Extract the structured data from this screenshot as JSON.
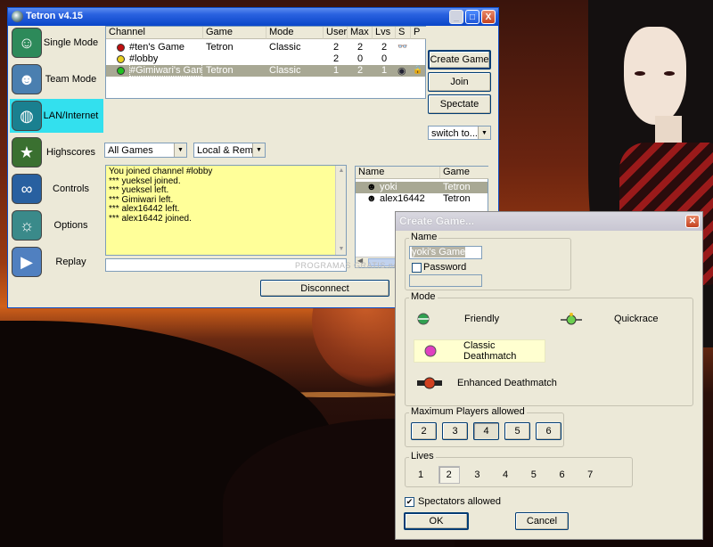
{
  "app": {
    "title": "Tetron v4.15",
    "window_buttons": [
      "_",
      "□",
      "X"
    ]
  },
  "nav": [
    {
      "label": "Single Mode",
      "icon": "single-mode-icon",
      "active": false
    },
    {
      "label": "Team Mode",
      "icon": "team-mode-icon",
      "active": false
    },
    {
      "label": "LAN/Internet",
      "icon": "globe-icon",
      "active": true
    },
    {
      "label": "Highscores",
      "icon": "highscores-icon",
      "active": false
    },
    {
      "label": "Controls",
      "icon": "controls-icon",
      "active": false
    },
    {
      "label": "Options",
      "icon": "options-icon",
      "active": false
    },
    {
      "label": "Replay",
      "icon": "replay-icon",
      "active": false
    }
  ],
  "channels": {
    "headers": [
      "Channel",
      "Game",
      "Mode",
      "User",
      "Max",
      "Lvs",
      "S",
      "P"
    ],
    "rows": [
      {
        "status": "#c01010",
        "channel": "#ten's Game",
        "game": "Tetron",
        "mode": "Classic",
        "user": "2",
        "max": "2",
        "lvs": "2",
        "selected": false
      },
      {
        "status": "#e8d020",
        "channel": "#lobby",
        "game": "",
        "mode": "",
        "user": "2",
        "max": "0",
        "lvs": "0",
        "selected": false
      },
      {
        "status": "#20c020",
        "channel": "#Gimiwari's Game",
        "game": "Tetron",
        "mode": "Classic",
        "user": "1",
        "max": "2",
        "lvs": "1",
        "selected": true
      }
    ]
  },
  "actions": {
    "create": "Create Game",
    "join": "Join",
    "spectate": "Spectate",
    "switch_to": "switch to..."
  },
  "filters": {
    "games": "All Games",
    "location": "Local & Remote"
  },
  "chat": {
    "lines": [
      "You joined channel #lobby",
      "*** yueksel joined.",
      "*** yueksel left.",
      "*** Gimiwari left.",
      "*** alex16442 left.",
      "*** alex16442 joined."
    ]
  },
  "users": {
    "headers": [
      "Name",
      "Game"
    ],
    "rows": [
      {
        "name": "yoki",
        "game": "Tetron",
        "selected": true
      },
      {
        "name": "alex16442",
        "game": "Tetron",
        "selected": false
      }
    ]
  },
  "disconnect": "Disconnect",
  "watermark": "PROGRAMAS GRATIS.net",
  "dialog": {
    "title": "Create Game...",
    "name_group": "Name",
    "name_value": "yoki's Game",
    "password_label": "Password",
    "mode_group": "Mode",
    "modes": [
      {
        "label": "Friendly",
        "selected": false
      },
      {
        "label": "Quickrace",
        "selected": false
      },
      {
        "label": "Classic Deathmatch",
        "selected": true
      },
      {
        "label": "Enhanced Deathmatch",
        "selected": false
      }
    ],
    "players_group": "Maximum Players allowed",
    "players": [
      "2",
      "3",
      "4",
      "5",
      "6"
    ],
    "players_selected": "4",
    "lives_group": "Lives",
    "lives": [
      "1",
      "2",
      "3",
      "4",
      "5",
      "6",
      "7"
    ],
    "lives_selected": "2",
    "spectators_label": "Spectators allowed",
    "spectators_checked": true,
    "ok": "OK",
    "cancel": "Cancel"
  }
}
